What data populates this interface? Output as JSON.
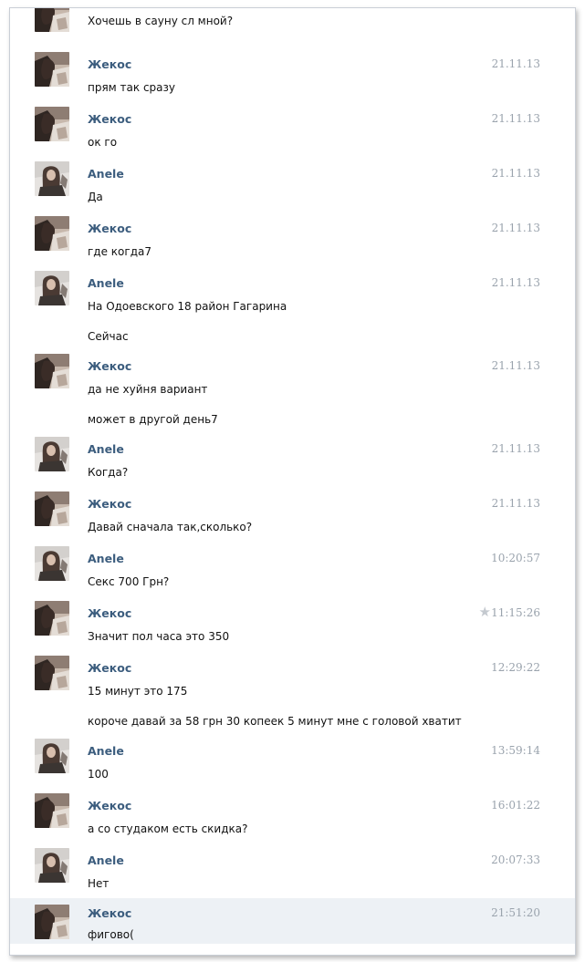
{
  "messages": [
    {
      "sender": "",
      "time": "",
      "avatar": "zhekos",
      "lines": [
        "Хочешь в сауну сл мной?"
      ],
      "top_line_only": true
    },
    {
      "sender": "Жекос",
      "time": "21.11.13",
      "avatar": "zhekos",
      "lines": [
        "прям так сразу"
      ]
    },
    {
      "sender": "Жекос",
      "time": "21.11.13",
      "avatar": "zhekos",
      "lines": [
        "ок го"
      ]
    },
    {
      "sender": "Anele",
      "time": "21.11.13",
      "avatar": "anele",
      "lines": [
        "Да"
      ]
    },
    {
      "sender": "Жекос",
      "time": "21.11.13",
      "avatar": "zhekos",
      "lines": [
        "где когда7"
      ]
    },
    {
      "sender": "Anele",
      "time": "21.11.13",
      "avatar": "anele",
      "lines": [
        "На Одоевского 18 район Гагарина",
        "Сейчас"
      ]
    },
    {
      "sender": "Жекос",
      "time": "21.11.13",
      "avatar": "zhekos",
      "lines": [
        "да не хуйня вариант",
        "может в другой день7"
      ]
    },
    {
      "sender": "Anele",
      "time": "21.11.13",
      "avatar": "anele",
      "lines": [
        "Когда?"
      ]
    },
    {
      "sender": "Жекос",
      "time": "21.11.13",
      "avatar": "zhekos",
      "lines": [
        "Давай сначала так,сколько?"
      ]
    },
    {
      "sender": "Anele",
      "time": "10:20:57",
      "avatar": "anele",
      "lines": [
        "Секс 700 Грн?"
      ]
    },
    {
      "sender": "Жекос",
      "time": "11:15:26",
      "avatar": "zhekos",
      "lines": [
        "Значит пол часа это 350"
      ],
      "star": true
    },
    {
      "sender": "Жекос",
      "time": "12:29:22",
      "avatar": "zhekos",
      "lines": [
        "15 минут это 175",
        "короче давай за 58 грн 30 копеек 5 минут мне с головой хватит"
      ]
    },
    {
      "sender": "Anele",
      "time": "13:59:14",
      "avatar": "anele",
      "lines": [
        "100"
      ]
    },
    {
      "sender": "Жекос",
      "time": "16:01:22",
      "avatar": "zhekos",
      "lines": [
        "а со студаком есть скидка?"
      ]
    },
    {
      "sender": "Anele",
      "time": "20:07:33",
      "avatar": "anele",
      "lines": [
        "Нет"
      ]
    },
    {
      "sender": "Жекос",
      "time": "21:51:20",
      "avatar": "zhekos",
      "lines": [
        "фигово("
      ],
      "highlight": true
    }
  ],
  "icons": {
    "star": "star-icon"
  },
  "colors": {
    "sender": "#3c5d7e",
    "time": "#9aa3ad",
    "highlight": "#edf1f5",
    "border": "#c9ced6"
  }
}
